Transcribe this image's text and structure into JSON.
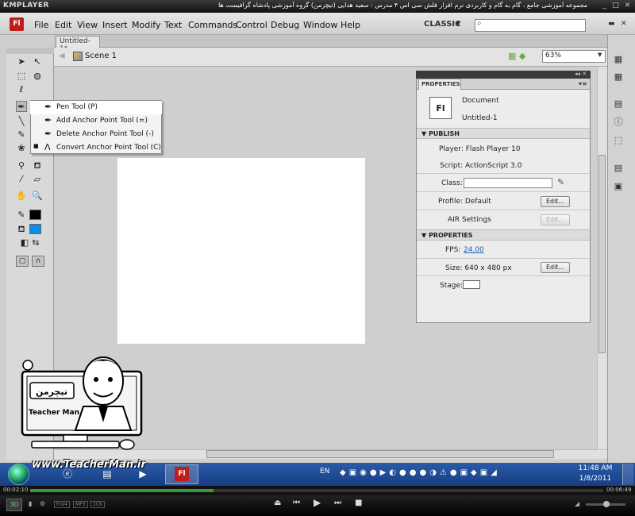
{
  "player": {
    "logo": "KMPLAYER",
    "caption": "مجموعه آموزشی جامع ، گام به گام و کاربردی نرم افزار فلش سی اس ۴ مدرس : سعید هدایی (تیچرمن) گروه آموزشی پادشاه گرافیست ها",
    "current_time": "00:02:10",
    "total_time": "00:06:49",
    "progress": 0.32,
    "volume": 0.52,
    "btn_3d": "3D",
    "codecs": [
      "FLV4",
      "MP3",
      "1CK"
    ]
  },
  "app": {
    "logo": "Fl",
    "menus": [
      "File",
      "Edit",
      "View",
      "Insert",
      "Modify",
      "Text",
      "Commands",
      "Control",
      "Debug",
      "Window",
      "Help"
    ],
    "workspace": "CLASSIC",
    "search_placeholder": ""
  },
  "document_tab": "Untitled-1*",
  "scene": "Scene 1",
  "zoom": "63%",
  "flyout": {
    "items": [
      {
        "label": "Pen Tool (P)",
        "selected": true
      },
      {
        "label": "Add Anchor Point Tool (=)",
        "selected": false
      },
      {
        "label": "Delete Anchor Point Tool (-)",
        "selected": false
      },
      {
        "label": "Convert Anchor Point Tool (C)",
        "selected": false
      }
    ]
  },
  "properties": {
    "tab": "PROPERTIES",
    "doc_type": "Document",
    "doc_name": "Untitled-1",
    "thumb": "Fl",
    "publish_header": "PUBLISH",
    "player": "Player: Flash Player 10",
    "script": "Script: ActionScript 3.0",
    "class_label": "Class:",
    "profile": "Profile: Default",
    "air": "AIR  Settings",
    "edit_label": "Edit...",
    "props_header": "PROPERTIES",
    "fps_label": "FPS:",
    "fps_value": "24.00",
    "size": "Size:  640 x 480 px",
    "stage_label": "Stage:",
    "colors": {
      "stroke": "#000000",
      "fill": "#0a8de8",
      "stage": "#ffffff"
    }
  },
  "taskbar": {
    "lang": "EN",
    "time": "11:48 AM",
    "date": "1/8/2011",
    "flash_app": "Fl"
  },
  "watermark": {
    "url": "www.TeacherMan.ir",
    "logo_text": "تیچرمن",
    "name": "Teacher Man"
  }
}
